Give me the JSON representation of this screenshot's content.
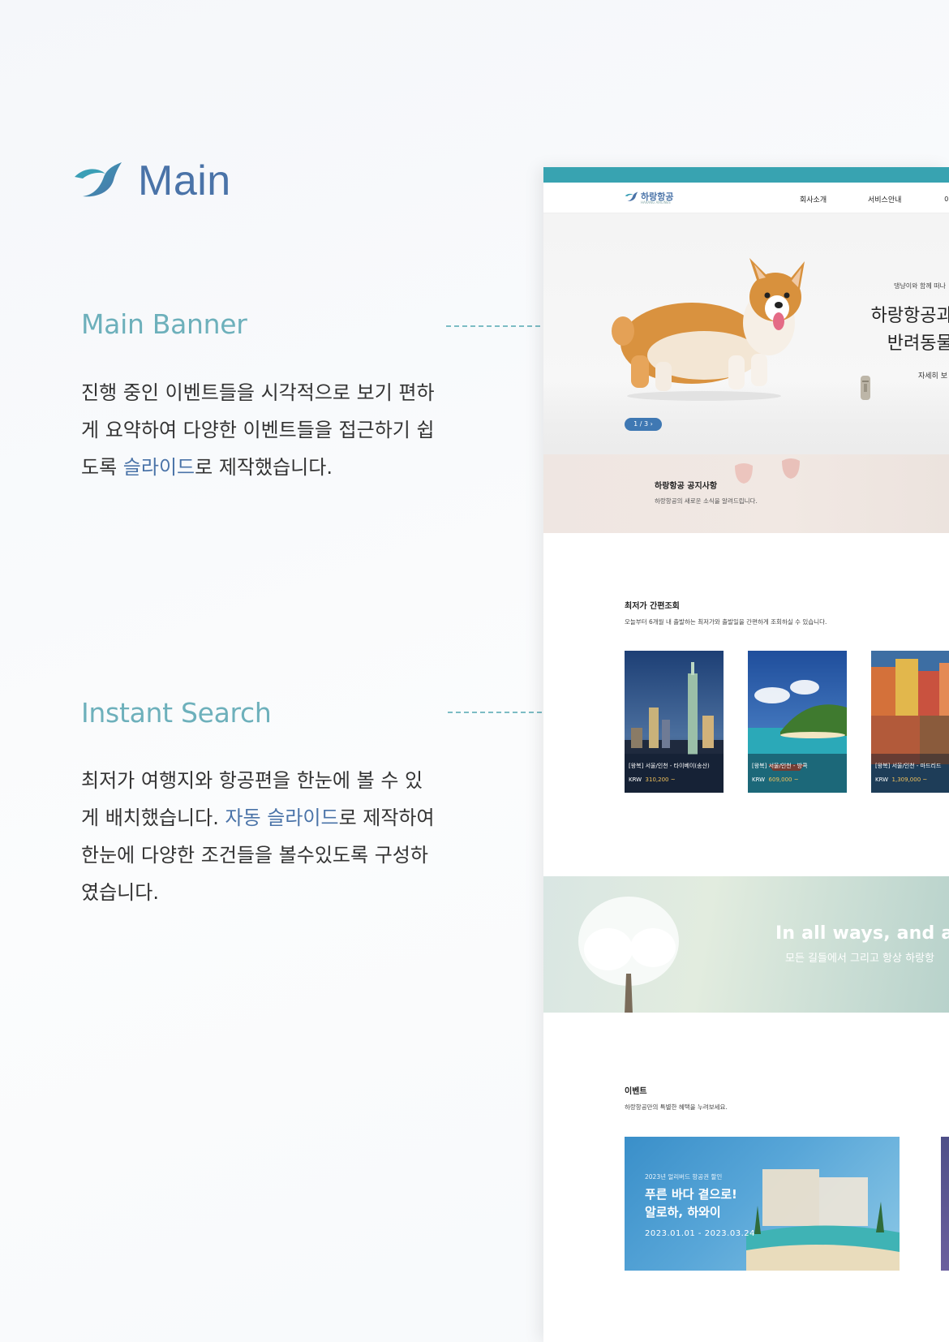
{
  "page": {
    "title": "Main",
    "accent_color": "#4a73a8",
    "section_color": "#6db0bb"
  },
  "sections": [
    {
      "title": "Main Banner",
      "body_lines": [
        "진행 중인 이벤트들을 시각적으로 보기 편하",
        "게 요약하여 다양한 이벤트들을 접근하기 쉽",
        [
          "도록 ",
          "슬라이드",
          "로 제작했습니다."
        ]
      ]
    },
    {
      "title": "Instant Search",
      "body_lines": [
        "최저가 여행지와 항공편을 한눈에 볼 수 있",
        [
          "게 배치했습니다. ",
          "자동 슬라이드",
          "로 제작하여"
        ],
        "한눈에 다양한 조건들을 볼수있도록 구성하",
        "였습니다."
      ]
    }
  ],
  "site": {
    "topbar_color": "#38a3b1",
    "logo": {
      "name": "하랑항공",
      "sub": "HARANG AIRLINES"
    },
    "nav": [
      "회사소개",
      "서비스안내",
      "이"
    ],
    "banner": {
      "eyebrow": "댕냥이와 함께 떠나",
      "title_lines": [
        "하랑항공과 함",
        "반려동물 동"
      ],
      "more": "자세히 보",
      "pager": "1 / 3  ›"
    },
    "notice": {
      "title": "하랑항공 공지사항",
      "subtitle": "하랑항공의 새로운 소식을 알려드립니다."
    },
    "instant_search": {
      "title": "최저가 간편조회",
      "subtitle": "오늘부터 6개월 내 출발하는 최저가와 출발일을 간편하게 조회하실 수 있습니다.",
      "cards": [
        {
          "route": "[왕복] 서울/인천 - 타이베이(송산)",
          "currency": "KRW",
          "price": "310,200 ~",
          "icon": "taipei-skyline-photo"
        },
        {
          "route": "[왕복] 서울/인천 - 방콕",
          "currency": "KRW",
          "price": "609,000 ~",
          "icon": "tropical-island-photo"
        },
        {
          "route": "[왕복] 서울/인천 - 마드리드",
          "currency": "KRW",
          "price": "1,309,000 ~",
          "icon": "colorful-town-photo"
        }
      ]
    },
    "slogan": {
      "en": "In all ways, and alw",
      "ko": "모든 길들에서 그리고 항상 하랑항"
    },
    "events": {
      "title": "이벤트",
      "subtitle": "하랑항공만의 특별한 혜택을 누려보세요.",
      "card": {
        "eyebrow": "2023년 얼리버드 항공권 할인",
        "title_lines": [
          "푸른 바다 곁으로!",
          "알로하, 하와이"
        ],
        "date": "2023.01.01 - 2023.03.24"
      }
    }
  }
}
